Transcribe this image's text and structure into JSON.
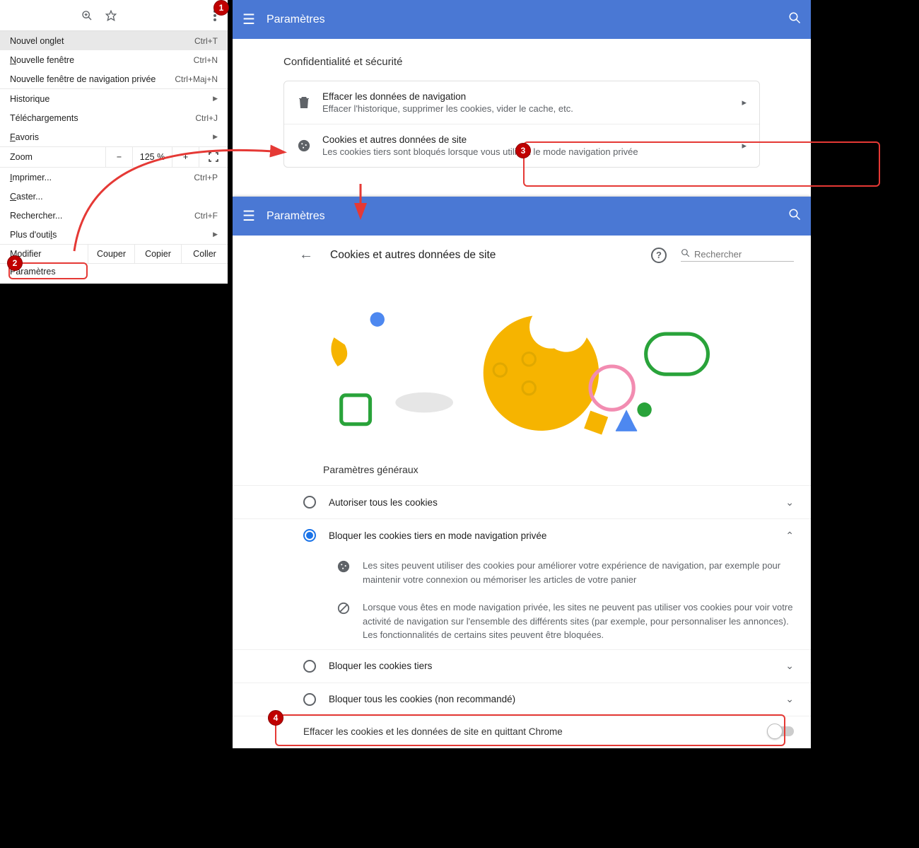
{
  "steps": {
    "s1": "1",
    "s2": "2",
    "s3": "3",
    "s4": "4"
  },
  "menu": {
    "new_tab": "Nouvel onglet",
    "new_tab_sc": "Ctrl+T",
    "new_window": "Nouvelle fenêtre",
    "new_window_sc": "Ctrl+N",
    "new_incognito": "Nouvelle fenêtre de navigation privée",
    "new_incognito_sc": "Ctrl+Maj+N",
    "history": "Historique",
    "downloads": "Téléchargements",
    "downloads_sc": "Ctrl+J",
    "favorites": "Favoris",
    "zoom_label": "Zoom",
    "zoom_minus": "−",
    "zoom_val": "125 %",
    "zoom_plus": "+",
    "print": "Imprimer...",
    "print_sc": "Ctrl+P",
    "cast": "Caster...",
    "find": "Rechercher...",
    "find_sc": "Ctrl+F",
    "more_tools": "Plus d'outils",
    "edit": "Modifier",
    "cut": "Couper",
    "copy": "Copier",
    "paste": "Coller",
    "settings": "Paramètres"
  },
  "header": {
    "title": "Paramètres"
  },
  "privacy": {
    "section": "Confidentialité et sécurité",
    "clear_title": "Effacer les données de navigation",
    "clear_sub": "Effacer l'historique, supprimer les cookies, vider le cache, etc.",
    "cookies_title": "Cookies et autres données de site",
    "cookies_sub": "Les cookies tiers sont bloqués lorsque vous utilisez le mode navigation privée"
  },
  "cookies_page": {
    "title": "Cookies et autres données de site",
    "search_ph": "Rechercher",
    "general": "Paramètres généraux",
    "opt_allow": "Autoriser tous les cookies",
    "opt_block_third_incog": "Bloquer les cookies tiers en mode navigation privée",
    "desc1": "Les sites peuvent utiliser des cookies pour améliorer votre expérience de navigation, par exemple pour maintenir votre connexion ou mémoriser les articles de votre panier",
    "desc2": "Lorsque vous êtes en mode navigation privée, les sites ne peuvent pas utiliser vos cookies pour voir votre activité de navigation sur l'ensemble des différents sites (par exemple, pour personnaliser les annonces). Les fonctionnalités de certains sites peuvent être bloquées.",
    "opt_block_third": "Bloquer les cookies tiers",
    "opt_block_all": "Bloquer tous les cookies (non recommandé)",
    "clear_on_exit": "Effacer les cookies et les données de site en quittant Chrome"
  }
}
